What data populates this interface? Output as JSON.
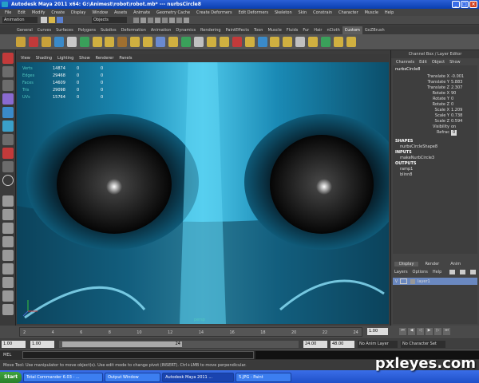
{
  "window": {
    "title": "Autodesk Maya 2011 x64: G:\\Animest\\robot\\robot.mb* --- nurbsCircle8",
    "minimize": "_",
    "maximize": "□",
    "close": "×"
  },
  "menubar": [
    "File",
    "Edit",
    "Modify",
    "Create",
    "Display",
    "Window",
    "Assets",
    "Animate",
    "Geometry Cache",
    "Create Deformers",
    "Edit Deformers",
    "Skeleton",
    "Skin",
    "Constrain",
    "Character",
    "Muscle",
    "Help"
  ],
  "statusline": {
    "menuset": "Animation",
    "selection_mode": "Objects"
  },
  "shelf": {
    "tabs": [
      "General",
      "Curves",
      "Surfaces",
      "Polygons",
      "Subdivs",
      "Deformation",
      "Animation",
      "Dynamics",
      "Rendering",
      "PaintEffects",
      "Toon",
      "Muscle",
      "Fluids",
      "Fur",
      "Hair",
      "nCloth",
      "Custom",
      "GoZBrush"
    ],
    "active_tab": "Custom"
  },
  "viewport": {
    "menu": [
      "View",
      "Shading",
      "Lighting",
      "Show",
      "Renderer",
      "Panels"
    ],
    "hud": [
      {
        "label": "Verts",
        "v1": "14874",
        "v2": "0",
        "v3": "0"
      },
      {
        "label": "Edges",
        "v1": "29468",
        "v2": "0",
        "v3": "0"
      },
      {
        "label": "Faces",
        "v1": "14609",
        "v2": "0",
        "v3": "0"
      },
      {
        "label": "Tris",
        "v1": "29098",
        "v2": "0",
        "v3": "0"
      },
      {
        "label": "UVs",
        "v1": "15764",
        "v2": "0",
        "v3": "0"
      }
    ],
    "camera_label": "persp"
  },
  "channel_box": {
    "header": "Channel Box / Layer Editor",
    "menu": [
      "Channels",
      "Edit",
      "Object",
      "Show"
    ],
    "object_name": "nurbsCircle8",
    "attributes": [
      {
        "name": "Translate X",
        "value": "-0.001"
      },
      {
        "name": "Translate Y",
        "value": "5.883"
      },
      {
        "name": "Translate Z",
        "value": "2.307"
      },
      {
        "name": "Rotate X",
        "value": "90"
      },
      {
        "name": "Rotate Y",
        "value": "0"
      },
      {
        "name": "Rotate Z",
        "value": "0"
      },
      {
        "name": "Scale X",
        "value": "1.209"
      },
      {
        "name": "Scale Y",
        "value": "0.738"
      },
      {
        "name": "Scale Z",
        "value": "0.594"
      },
      {
        "name": "Visibility",
        "value": "on"
      },
      {
        "name": "Refrac",
        "value": "0"
      }
    ],
    "shapes_label": "SHAPES",
    "shapes": [
      "nurbsCircleShape8"
    ],
    "inputs_label": "INPUTS",
    "inputs": [
      "makeNurbCircle3"
    ],
    "outputs_label": "OUTPUTS",
    "outputs": [
      "ramp1",
      "blinn8"
    ]
  },
  "layer_editor": {
    "tabs": [
      "Display",
      "Render",
      "Anim"
    ],
    "menu": [
      "Layers",
      "Options",
      "Help"
    ],
    "layer": {
      "v": "V",
      "name": "layer1"
    }
  },
  "timeline": {
    "ticks": [
      "2",
      "4",
      "6",
      "8",
      "10",
      "12",
      "14",
      "16",
      "18",
      "20",
      "22",
      "24"
    ],
    "current_frame": "1.00"
  },
  "range": {
    "start": "1.00",
    "start2": "1.00",
    "slider_val": "24",
    "end": "24.00",
    "end2": "48.00",
    "anim_layer": "No Anim Layer",
    "char_set": "No Character Set"
  },
  "cmdline": {
    "label": "MEL"
  },
  "helpline": {
    "text": "Move Tool: Use manipulator to move object(s). Use edit mode to change pivot (INSERT). Ctrl+LMB to move perpendicular."
  },
  "taskbar": {
    "start": "Start",
    "items": [
      "Total Commander 6.03 - ...",
      "Output Window",
      "Autodesk Maya 2011 ...",
      "5.JPG - Paint"
    ],
    "active_index": 2
  },
  "watermark": "pxleyes.com",
  "colors": {
    "model_cyan": "#1f95c0",
    "model_dark": "#0a3345",
    "eye": "#1a1a1a"
  }
}
